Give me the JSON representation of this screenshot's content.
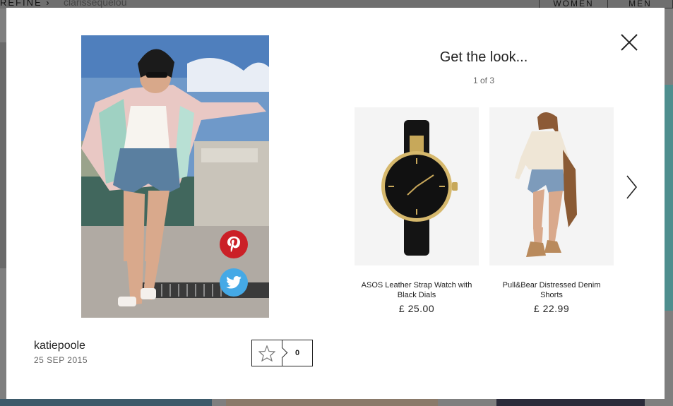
{
  "background": {
    "refine_label": "REFINE ›",
    "user_text": "clarissequelou",
    "tabs": [
      "WOMEN",
      "MEN"
    ]
  },
  "modal": {
    "title": "Get the look...",
    "counter": "1 of 3",
    "products": [
      {
        "name": "ASOS Leather Strap Watch with Black Dials",
        "price": "£ 25.00"
      },
      {
        "name": "Pull&Bear Distressed Denim Shorts",
        "price": "£ 22.99"
      }
    ],
    "user": {
      "name": "katiepoole",
      "date": "25 SEP 2015"
    },
    "likes": {
      "count": "0"
    }
  },
  "icons": {
    "close": "close-icon",
    "next": "chevron-right-icon",
    "star": "star-icon",
    "pinterest": "pinterest-icon",
    "twitter": "twitter-icon"
  },
  "colors": {
    "pinterest": "#cb2027",
    "twitter": "#45a9e6",
    "overlay": "#7f7f7f"
  }
}
